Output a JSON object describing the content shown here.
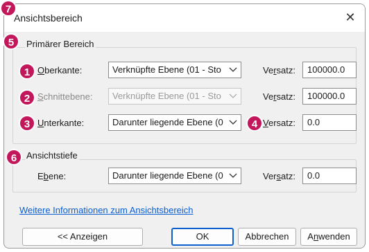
{
  "window": {
    "title": "Ansichtsbereich",
    "close_icon": "close-icon"
  },
  "badges": [
    "1",
    "2",
    "3",
    "4",
    "5",
    "6",
    "7"
  ],
  "primary_range": {
    "title": "Primärer Bereich",
    "rows": [
      {
        "label_ul": "O",
        "label_rest": "berkante:",
        "select_value": "Verknüpfte Ebene (01 - Sto",
        "offset_label_pre": "Ve",
        "offset_label_ul": "r",
        "offset_label_post": "satz:",
        "offset_value": "100000.0",
        "disabled": false
      },
      {
        "label_ul": "S",
        "label_rest": "chnittebene:",
        "select_value": "Verknüpfte Ebene (01 - Sto",
        "offset_label_pre": "Ve",
        "offset_label_ul": "r",
        "offset_label_post": "satz:",
        "offset_value": "100000.0",
        "disabled": true
      },
      {
        "label_ul": "U",
        "label_rest": "nterkante:",
        "select_value": "Darunter liegende Ebene (0",
        "offset_label_pre": "",
        "offset_label_ul": "V",
        "offset_label_post": "ersatz:",
        "offset_value": "0.0",
        "disabled": false
      }
    ]
  },
  "view_depth": {
    "title": "Ansichtstiefe",
    "label_pre": "E",
    "label_ul": "b",
    "label_post": "ene:",
    "select_value": "Darunter liegende Ebene (0",
    "offset_label_pre": "Ver",
    "offset_label_ul": "s",
    "offset_label_post": "atz:",
    "offset_value": "0.0"
  },
  "link_text": "Weitere Informationen zum Ansichtsbereich",
  "buttons": {
    "show": "<< Anzeigen",
    "ok": "OK",
    "cancel": "Abbrechen",
    "apply_pre": "A",
    "apply_ul": "n",
    "apply_post": "wenden"
  },
  "colors": {
    "badge": "#c2185b",
    "link": "#0b5fd1",
    "focus": "#0b5fd1"
  }
}
